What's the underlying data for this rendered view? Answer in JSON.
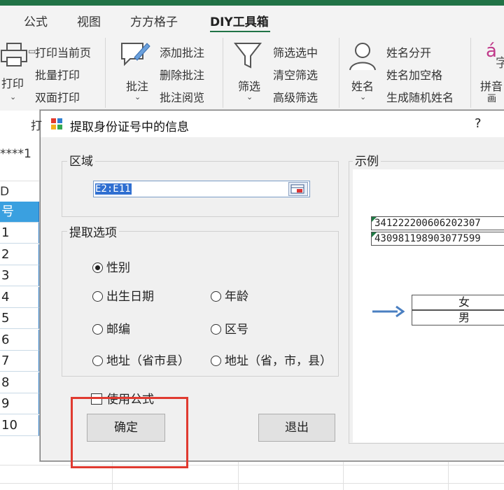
{
  "ribbon_tabs": [
    "公式",
    "视图",
    "方方格子",
    "DIY工具箱"
  ],
  "ribbon": {
    "print": {
      "big_label": "打印",
      "items": [
        "打印当前页",
        "批量打印",
        "双面打印"
      ],
      "group_label": "打"
    },
    "comment": {
      "big_label": "批注",
      "items": [
        "添加批注",
        "删除批注",
        "批注阅览"
      ]
    },
    "filter": {
      "big_label": "筛选",
      "items": [
        "筛选选中",
        "清空筛选",
        "高级筛选"
      ]
    },
    "name": {
      "big_label": "姓名",
      "items": [
        "姓名分开",
        "姓名加空格",
        "生成随机姓名"
      ]
    },
    "pinyin": {
      "big_label": "拼音",
      "sub_label": "画"
    }
  },
  "sheet": {
    "formula_fragment": "****1",
    "column_header": "D",
    "header_cell": "号",
    "row_numbers": [
      "1",
      "2",
      "3",
      "4",
      "5",
      "6",
      "7",
      "8",
      "9",
      "10"
    ]
  },
  "dialog": {
    "title": "提取身份证号中的信息",
    "help": "?",
    "area": {
      "label": "区域",
      "value": "E2:E11"
    },
    "options": {
      "label": "提取选项",
      "radios": [
        {
          "label": "性别",
          "selected": true
        },
        {
          "label": "出生日期",
          "selected": false
        },
        {
          "label": "年龄",
          "selected": false
        },
        {
          "label": "邮编",
          "selected": false
        },
        {
          "label": "区号",
          "selected": false
        },
        {
          "label": "地址（省市县）",
          "selected": false
        },
        {
          "label": "地址（省，市，县）",
          "selected": false
        }
      ]
    },
    "use_formula": {
      "label": "使用公式",
      "checked": false
    },
    "ok": "确定",
    "exit": "退出",
    "example": {
      "label": "示例",
      "ids": [
        "341222200606202307",
        "430981198903077599"
      ],
      "results": [
        "女",
        "男"
      ]
    }
  },
  "colors": {
    "accent": "#217346",
    "highlight": "#e03a30",
    "header_cell": "#3aa0e0"
  }
}
